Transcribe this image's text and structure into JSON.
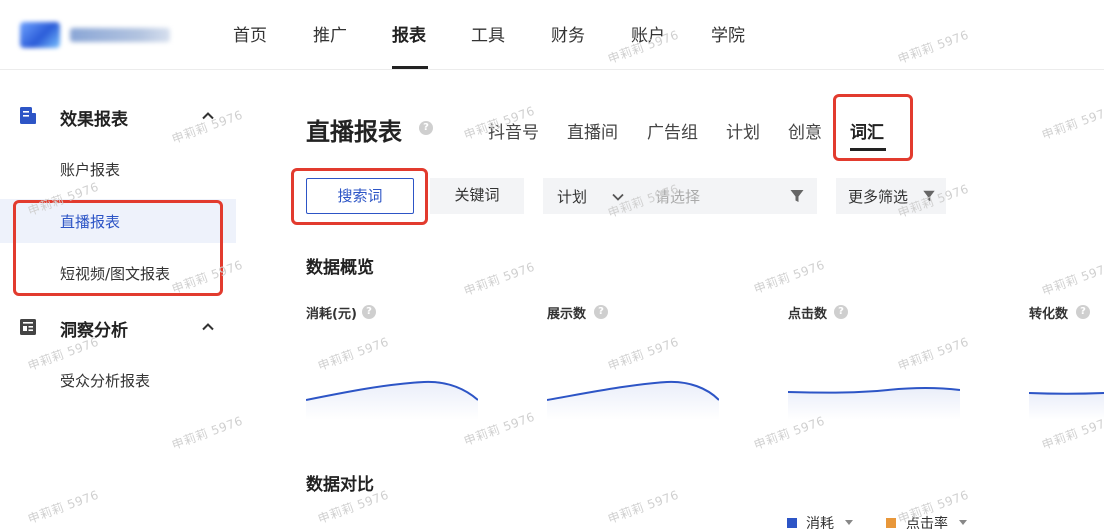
{
  "colors": {
    "accent": "#2d55c6",
    "highlight": "#e23b2e",
    "legend_cost": "#2d55c6",
    "legend_ctr": "#e8973a"
  },
  "topnav": {
    "items": [
      {
        "label": "首页"
      },
      {
        "label": "推广"
      },
      {
        "label": "报表",
        "active": true
      },
      {
        "label": "工具"
      },
      {
        "label": "财务"
      },
      {
        "label": "账户"
      },
      {
        "label": "学院"
      }
    ]
  },
  "sidebar": {
    "sections": [
      {
        "label": "效果报表",
        "icon": "report-icon",
        "items": [
          {
            "label": "账户报表"
          },
          {
            "label": "直播报表",
            "active": true
          },
          {
            "label": "短视频/图文报表"
          }
        ]
      },
      {
        "label": "洞察分析",
        "icon": "insight-icon",
        "items": [
          {
            "label": "受众分析报表"
          }
        ]
      }
    ]
  },
  "main": {
    "title": "直播报表",
    "tabs": [
      {
        "label": "抖音号"
      },
      {
        "label": "直播间"
      },
      {
        "label": "广告组"
      },
      {
        "label": "计划"
      },
      {
        "label": "创意"
      },
      {
        "label": "词汇",
        "active": true
      }
    ],
    "segment": {
      "active": "搜索词",
      "other": "关键词"
    },
    "filter": {
      "label": "计划",
      "placeholder": "请选择",
      "more": "更多筛选"
    },
    "overview": {
      "title": "数据概览",
      "metrics": [
        {
          "label": "消耗(元)"
        },
        {
          "label": "展示数"
        },
        {
          "label": "点击数"
        },
        {
          "label": "转化数"
        }
      ]
    },
    "compare": {
      "title": "数据对比",
      "legend": [
        {
          "label": "消耗"
        },
        {
          "label": "点击率"
        }
      ]
    }
  },
  "watermark": {
    "text": "申莉莉 5976"
  }
}
